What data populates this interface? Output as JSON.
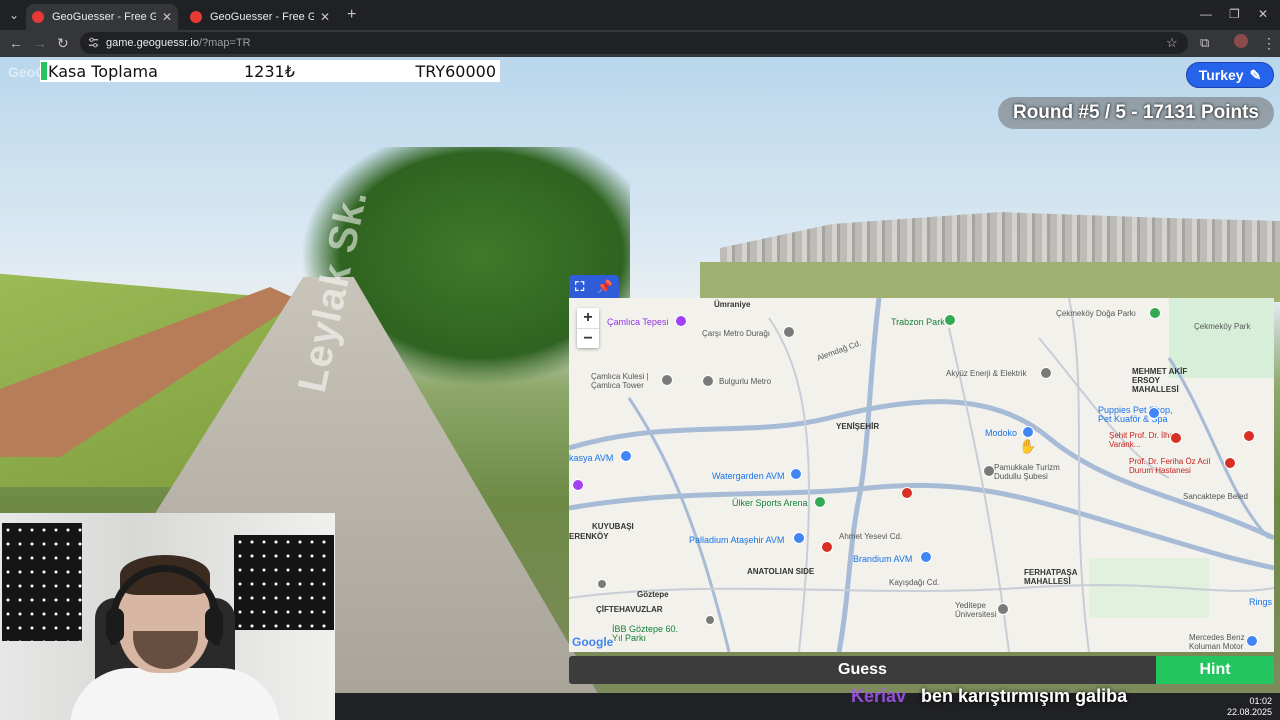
{
  "browser": {
    "tabs": [
      {
        "title": "GeoGuesser - Free GeoGuessr Z",
        "active": true
      },
      {
        "title": "GeoGuesser - Free GeoGuessr",
        "active": false
      }
    ],
    "url_host": "game.geoguessr.io",
    "url_path": "/?map=TR"
  },
  "overlay": {
    "logo_text": "GeoGuessr",
    "info_label": "Kasa Toplama",
    "info_amount": "1231₺",
    "info_total": "TRY60000"
  },
  "game": {
    "country_label": "Turkey",
    "round_text": "Round #5 / 5 - 17131 Points",
    "guess_label": "Guess",
    "hint_label": "Hint",
    "street_sign": "Leylak Sk."
  },
  "map": {
    "zoom_in": "+",
    "zoom_out": "−",
    "google_logo": "Google",
    "labels": [
      {
        "id": "umraniye",
        "text": "Ümraniye",
        "cls": "dark"
      },
      {
        "id": "camlica-tepesi",
        "text": "Çamlıca Tepesi",
        "cls": "purple"
      },
      {
        "id": "carsi-metro",
        "text": "Çarşı Metro Durağı",
        "cls": ""
      },
      {
        "id": "trabzon-park",
        "text": "Trabzon Park",
        "cls": "green"
      },
      {
        "id": "cekmekoy-doga",
        "text": "Çekmeköy Doğa Parkı",
        "cls": ""
      },
      {
        "id": "cekmekoy",
        "text": "Çekmeköy Park",
        "cls": ""
      },
      {
        "id": "camlica-kulesi",
        "text": "Çamlıca Kulesi | Çamlıca Tower",
        "cls": ""
      },
      {
        "id": "bulgurlu",
        "text": "Bulgurlu Metro",
        "cls": ""
      },
      {
        "id": "akyuz",
        "text": "Akyüz Enerji & Elektrik",
        "cls": ""
      },
      {
        "id": "mehmet",
        "text": "MEHMET AKİF ERSOY MAHALLESİ",
        "cls": "dark"
      },
      {
        "id": "puppies",
        "text": "Puppies Pet Shop, Pet Kuaför & Spa",
        "cls": "blue"
      },
      {
        "id": "yenisehir",
        "text": "YENİŞEHİR",
        "cls": "dark"
      },
      {
        "id": "modoko",
        "text": "Modoko",
        "cls": "blue"
      },
      {
        "id": "sehit",
        "text": "Şehit Prof. Dr. İlhan Varank...",
        "cls": "red"
      },
      {
        "id": "feriha",
        "text": "Prof. Dr. Feriha Öz Acil Durum Hastanesi",
        "cls": "red"
      },
      {
        "id": "kasya",
        "text": "kasya AVM",
        "cls": "blue"
      },
      {
        "id": "watergarden",
        "text": "Watergarden AVM",
        "cls": "blue"
      },
      {
        "id": "pamukkale",
        "text": "Pamukkale Turizm Dudullu Şubesi",
        "cls": ""
      },
      {
        "id": "ulker",
        "text": "Ülker Sports Arena",
        "cls": "green"
      },
      {
        "id": "sancaktepe",
        "text": "Sancaktepe Beled",
        "cls": ""
      },
      {
        "id": "kuyubasi",
        "text": "KUYUBAŞI",
        "cls": "dark"
      },
      {
        "id": "erenkoy",
        "text": "ERENKÖY",
        "cls": "dark"
      },
      {
        "id": "palladium",
        "text": "Palladium Ataşehir AVM",
        "cls": "blue"
      },
      {
        "id": "brandium",
        "text": "Brandium AVM",
        "cls": "blue"
      },
      {
        "id": "anatolian",
        "text": "ANATOLIAN SIDE",
        "cls": "dark"
      },
      {
        "id": "ferhatpasa",
        "text": "FERHATPAŞA MAHALLESİ",
        "cls": "dark"
      },
      {
        "id": "goztepe",
        "text": "Göztepe",
        "cls": "dark"
      },
      {
        "id": "ciftehavuzlar",
        "text": "ÇİFTEHAVUZLAR",
        "cls": "dark"
      },
      {
        "id": "ibb",
        "text": "İBB Göztepe 60. Yıl Parkı",
        "cls": "green"
      },
      {
        "id": "yeditepe",
        "text": "Yeditepe Üniversitesi",
        "cls": ""
      },
      {
        "id": "mercedes",
        "text": "Mercedes Benz Koluman Motor",
        "cls": ""
      },
      {
        "id": "rings",
        "text": "Rings A",
        "cls": "blue"
      },
      {
        "id": "ahmet-yesevi",
        "text": "Ahmet Yesevi Cd.",
        "cls": ""
      },
      {
        "id": "alemdag",
        "text": "Alemdağ Cd.",
        "cls": ""
      },
      {
        "id": "kayisdagi",
        "text": "Kayışdağı Cd.",
        "cls": ""
      }
    ]
  },
  "stream": {
    "chat_user": "Keriav",
    "chat_message": "ben karıştırmışım galiba",
    "time": "01:02",
    "date": "22.08.2025"
  },
  "colors": {
    "accent_blue": "#2563eb",
    "hint_green": "#22c55e",
    "guess_gray": "#3c3c3c"
  }
}
